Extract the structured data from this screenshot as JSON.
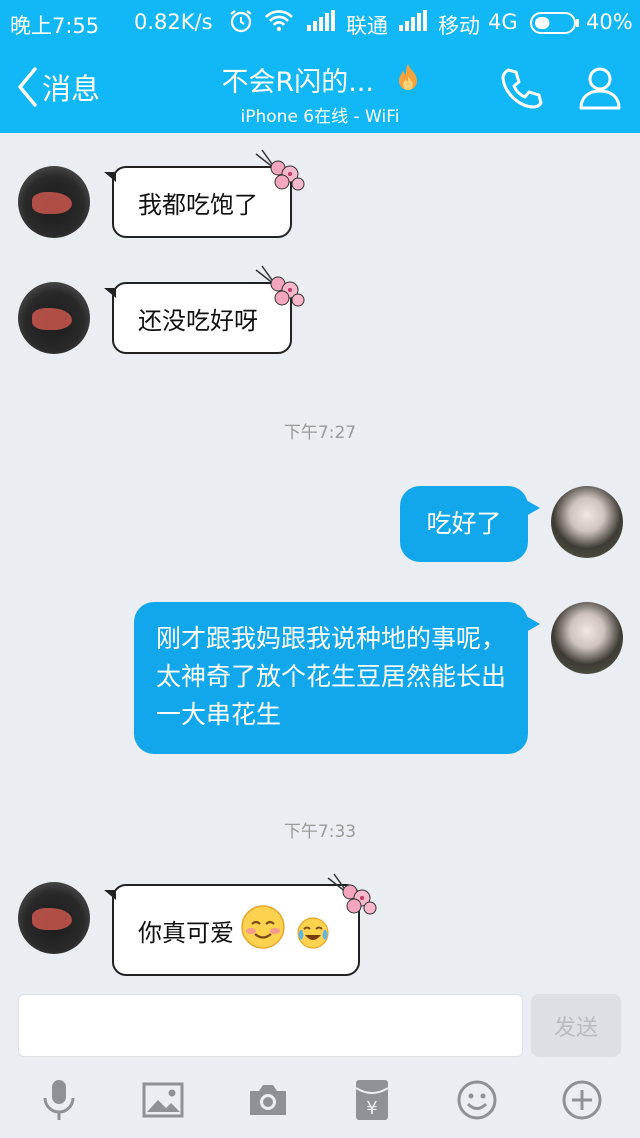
{
  "status_bar": {
    "time": "晚上7:55",
    "speed": "0.82K/s",
    "carrier1": "联通",
    "carrier2": "移动",
    "network": "4G",
    "battery": "40%",
    "battery_level": 0.4
  },
  "nav": {
    "back_label": "消息",
    "title": "不会R闪的...",
    "subtitle": "iPhone 6在线 - WiFi"
  },
  "messages": [
    {
      "side": "left",
      "text": "我都吃饱了"
    },
    {
      "side": "left",
      "text": "还没吃好呀"
    },
    {
      "timestamp": "下午7:27"
    },
    {
      "side": "right",
      "text": "吃好了"
    },
    {
      "side": "right",
      "text": "刚才跟我妈跟我说种地的事呢，太神奇了放个花生豆居然能长出一大串花生"
    },
    {
      "timestamp": "下午7:33"
    },
    {
      "side": "left",
      "text": "你真可爱"
    }
  ],
  "input": {
    "value": "",
    "placeholder": "",
    "send_label": "发送"
  },
  "toolbar": [
    "microphone-icon",
    "image-icon",
    "camera-icon",
    "red-packet-icon",
    "emoji-icon",
    "plus-icon"
  ],
  "colors": {
    "accent": "#12b7f5",
    "bubble_right": "#12a7ea",
    "background": "#eaedf2"
  }
}
